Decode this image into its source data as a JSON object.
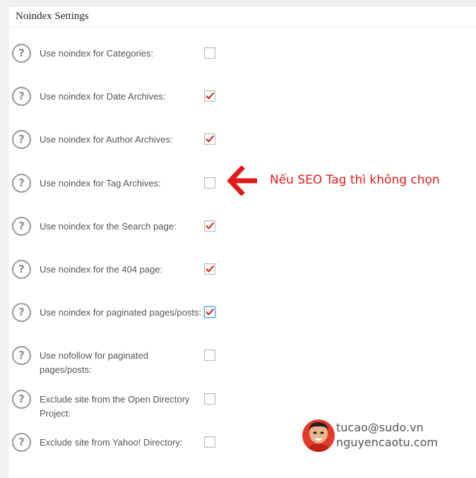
{
  "panel": {
    "title": "Noindex Settings"
  },
  "settings": [
    {
      "label": "Use noindex for Categories:",
      "checked": false
    },
    {
      "label": "Use noindex for Date Archives:",
      "checked": true
    },
    {
      "label": "Use noindex for Author Archives:",
      "checked": true
    },
    {
      "label": "Use noindex for Tag Archives:",
      "checked": false
    },
    {
      "label": "Use noindex for the Search page:",
      "checked": true
    },
    {
      "label": "Use noindex for the 404 page:",
      "checked": true
    },
    {
      "label": "Use noindex for paginated pages/posts:",
      "checked": true,
      "focused": true
    },
    {
      "label": "Use nofollow for paginated pages/posts:",
      "checked": false
    },
    {
      "label": "Exclude site from the Open Directory Project:",
      "checked": false
    },
    {
      "label": "Exclude site from Yahoo! Directory:",
      "checked": false
    }
  ],
  "help_icon_glyph": "?",
  "annotation": {
    "text": "Nếu SEO Tag thì không chọn",
    "color": "#e0191b",
    "icon": "left-arrow-icon"
  },
  "watermark": {
    "email": "tucao@sudo.vn",
    "site": "nguyencaotu.com",
    "icon": "avatar"
  },
  "colors": {
    "check_mark": "#d9372b",
    "focus_border": "#5b9dd9",
    "label_text": "#555555"
  }
}
